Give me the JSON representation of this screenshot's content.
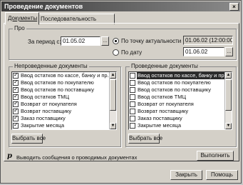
{
  "window": {
    "title": "Проведение документов",
    "close_glyph": "×"
  },
  "tabs": [
    {
      "label": "Документы",
      "active": true
    },
    {
      "label": "Последовательность",
      "active": false
    }
  ],
  "period_group": {
    "legend": "Про",
    "period_label": "За период с:",
    "period_value": "01.05.02",
    "picker_glyph": "…",
    "radio_actual": {
      "label": "По точку актуальности",
      "selected": true,
      "value": "01.06.02 (12:00:00)"
    },
    "radio_date": {
      "label": "По дату",
      "selected": false,
      "value": "01.06.02"
    }
  },
  "left_list": {
    "title": "Непроведенные документы",
    "items": [
      {
        "label": "Ввод остатков по кассе, банку и пр.",
        "checked": true
      },
      {
        "label": "Ввод остатков по покупателю",
        "checked": true
      },
      {
        "label": "Ввод остатков по поставщику",
        "checked": true
      },
      {
        "label": "Ввод остатков ТМЦ",
        "checked": true
      },
      {
        "label": "Возврат от покупателя",
        "checked": true
      },
      {
        "label": "Возврат поставщику",
        "checked": true
      },
      {
        "label": "Заказ поставщику",
        "checked": true
      },
      {
        "label": "Закрытие месяца",
        "checked": true
      }
    ],
    "select_all": "Выбрать все"
  },
  "right_list": {
    "title": "Проведенные документы",
    "items": [
      {
        "label": "Ввод остатков по кассе, банку и пр.",
        "checked": false,
        "selected": true
      },
      {
        "label": "Ввод остатков по покупателю",
        "checked": false
      },
      {
        "label": "Ввод остатков по поставщику",
        "checked": false
      },
      {
        "label": "Ввод остатков ТМЦ",
        "checked": false
      },
      {
        "label": "Возврат от покупателя",
        "checked": false
      },
      {
        "label": "Возврат поставщику",
        "checked": false
      },
      {
        "label": "Заказ поставщику",
        "checked": false
      },
      {
        "label": "Закрытие месяца",
        "checked": false
      }
    ],
    "select_all": "Выбрать все"
  },
  "hint": {
    "icon": "p",
    "text": "Выводить сообщения о проводимых документах"
  },
  "buttons": {
    "execute": "Выполнить",
    "close": "Закрыть",
    "help": "Помощь"
  }
}
